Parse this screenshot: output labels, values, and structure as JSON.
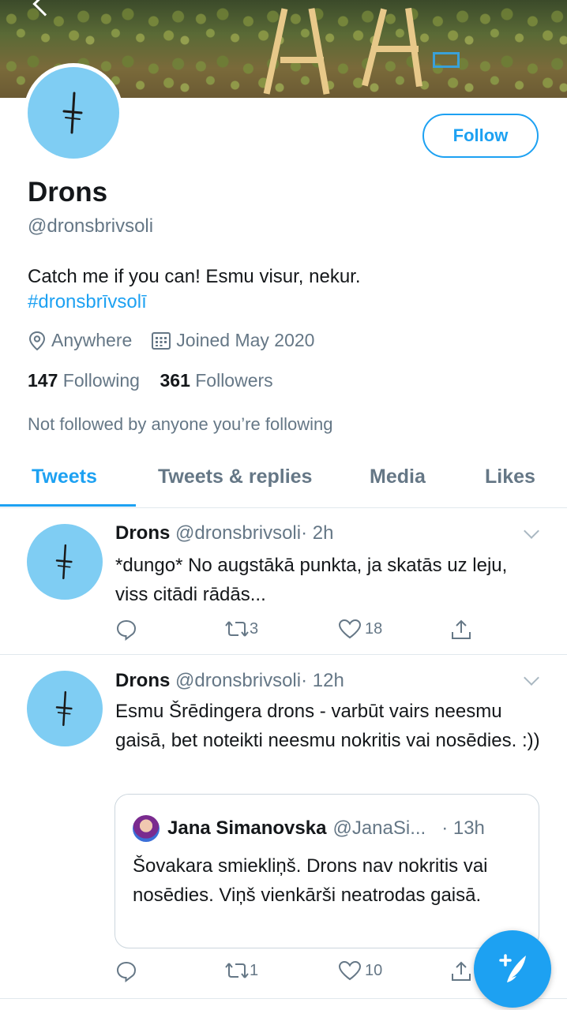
{
  "profile": {
    "name": "Drons",
    "handle": "@dronsbrivsoli",
    "bio_text": "Catch me if you can! Esmu visur, nekur.",
    "bio_hashtag": "#dronsbrīvsolī",
    "location": "Anywhere",
    "joined": "Joined May 2020",
    "following_count": "147",
    "following_label": "Following",
    "followers_count": "361",
    "followers_label": "Followers",
    "not_followed": "Not followed by anyone you’re following",
    "follow_button": "Follow"
  },
  "tabs": [
    {
      "label": "Tweets",
      "active": true
    },
    {
      "label": "Tweets & replies",
      "active": false
    },
    {
      "label": "Media",
      "active": false
    },
    {
      "label": "Likes",
      "active": false
    }
  ],
  "tweets": [
    {
      "name": "Drons",
      "handle": "@dronsbrivsoli",
      "time": "· 2h",
      "text": "*dungo* No augstākā punkta, ja skatās uz leju, viss citādi rādās...",
      "replies": "",
      "retweets": "3",
      "likes": "18"
    },
    {
      "name": "Drons",
      "handle": "@dronsbrivsoli",
      "time": "· 12h",
      "text": "Esmu Šrēdingera drons - varbūt vairs neesmu gaisā, bet noteikti neesmu nokritis vai nosēdies. :))",
      "quote": {
        "name": "Jana Simanovska",
        "handle": "@JanaSi...",
        "time": "· 13h",
        "text": "Šovakara smiekliņš. Drons nav nokritis vai nosēdies. Viņš vienkārši neatrodas gaisā."
      },
      "replies": "",
      "retweets": "1",
      "likes": "10"
    }
  ],
  "colors": {
    "accent": "#1da1f2",
    "muted": "#657786",
    "avatar_bg": "#7fcdf3"
  },
  "icons": {
    "location": "location-pin-icon",
    "joined": "calendar-icon",
    "reply": "reply-icon",
    "retweet": "retweet-icon",
    "like": "heart-icon",
    "share": "share-icon",
    "compose": "compose-tweet-icon"
  }
}
